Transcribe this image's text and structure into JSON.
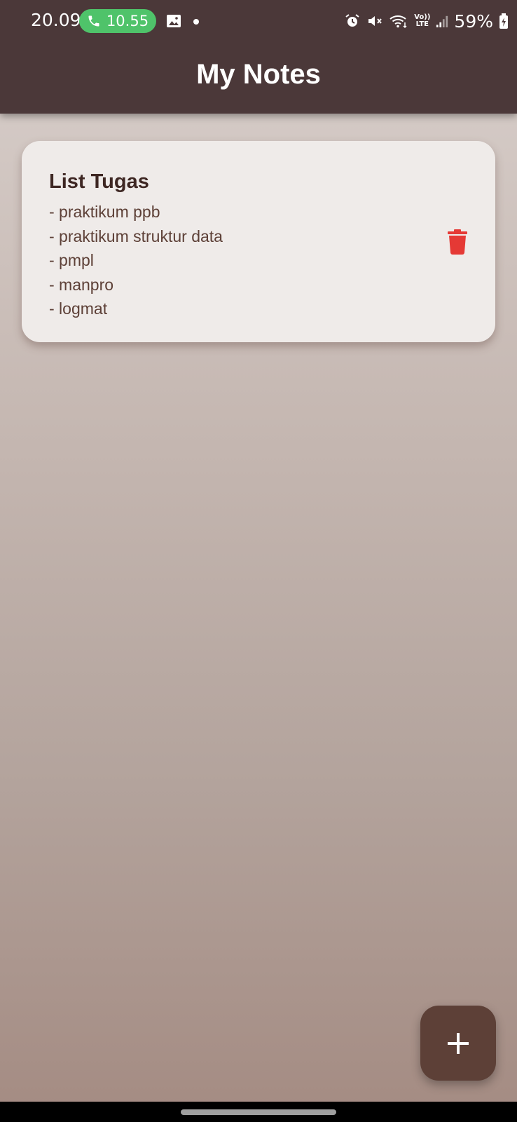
{
  "status_bar": {
    "time": "20.09",
    "call_duration": "10.55",
    "network_label_top": "Vo))",
    "network_label_bottom": "LTE",
    "battery": "59%"
  },
  "app_bar": {
    "title": "My Notes"
  },
  "notes": [
    {
      "title": "List Tugas",
      "lines": [
        "- praktikum ppb",
        "- praktikum struktur data",
        "- pmpl",
        "- manpro",
        "- logmat"
      ]
    }
  ],
  "colors": {
    "app_bar": "#4b3839",
    "card": "#efebe9",
    "delete": "#e53935",
    "fab": "#5d4037",
    "call_pill": "#4fc36a"
  },
  "icons": {
    "delete": "trash-icon",
    "fab": "plus-icon"
  }
}
